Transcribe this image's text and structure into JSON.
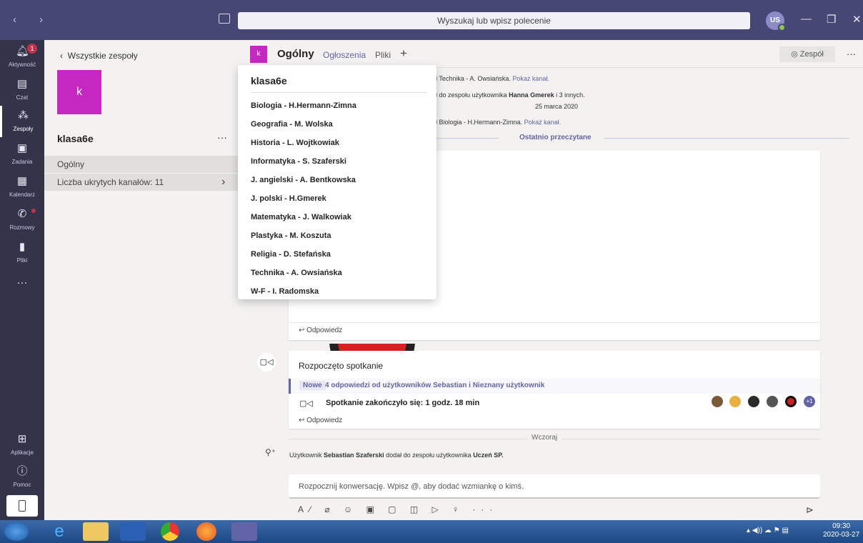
{
  "titlebar": {
    "nav_arrows": "‹ ›",
    "search_placeholder": "Wyszukaj lub wpisz polecenie",
    "avatar_initials": "US",
    "min": "—",
    "restore": "❐",
    "close": "✕"
  },
  "rail": [
    {
      "label": "Aktywność",
      "icon": "bell-icon",
      "badge": "1"
    },
    {
      "label": "Czat",
      "icon": "chat-icon"
    },
    {
      "label": "Zespoły",
      "icon": "teams-icon",
      "active": true
    },
    {
      "label": "Zadania",
      "icon": "assignments-icon"
    },
    {
      "label": "Kalendarz",
      "icon": "calendar-icon"
    },
    {
      "label": "Rozmowy",
      "icon": "phone-icon"
    },
    {
      "label": "Pliki",
      "icon": "file-icon"
    },
    {
      "label": "",
      "icon": "more-icon"
    },
    {
      "label": "Aplikacje",
      "icon": "apps-icon"
    },
    {
      "label": "Pomoc",
      "icon": "help-icon"
    }
  ],
  "left": {
    "back_label": "Wszystkie zespoły",
    "team_initial": "k",
    "team_name": "klasa6e",
    "more": "···",
    "channel_general": "Ogólny",
    "hidden_channels": "Liczba ukrytych kanałów: 11"
  },
  "header": {
    "tile_initial": "k",
    "title": "Ogólny",
    "tab_posts": "Ogłoszenia",
    "tab_files": "Pliki",
    "add": "+",
    "team_button": "◎ Zespół",
    "more": "···"
  },
  "feed": {
    "sys1_pre": "ł Technika - A. Owsiańska.",
    "sys1_link": "Pokaż kanał.",
    "sys2_pre": "ł do zespołu użytkownika",
    "sys2_bold": "Hanna Gmerek",
    "sys2_post": "i 3 innych.",
    "date": "25 marca 2020",
    "sys3_pre": "ł Biologia - H.Hermann-Zimna.",
    "sys3_link": "Pokaż kanał.",
    "last_read": "Ostatnio przeczytane",
    "reply1": "↩ Odpowiedz",
    "meeting_title": "Rozpoczęto spotkanie",
    "new_badge": "Nowe",
    "new_text": "4 odpowiedzi od użytkowników Sebastian i Nieznany użytkownik",
    "meeting_end": "Spotkanie zakończyło się: 1 godz. 18 min",
    "plus_count": "+1",
    "reply2": "↩ Odpowiedz",
    "yesterday": "Wczoraj",
    "added_pre": "Użytkownik",
    "added_user": "Sebastian Szaferski",
    "added_mid": "dodał do zespołu użytkownika",
    "added_target": "Uczeń SP.",
    "compose_placeholder": "Rozpocznij konwersację. Wpisz @, aby dodać wzmiankę o kimś.",
    "tools": "A⁄ ⌀ ☺ ▣ ▢ ◫ ▷ ♀ ···",
    "send": "⊳"
  },
  "dropdown": {
    "title": "klasa6e",
    "items": [
      "Biologia - H.Hermann-Zimna",
      "Geografia - M. Wolska",
      "Historia - L. Wojtkowiak",
      "Informatyka - S. Szaferski",
      "J. angielski - A. Bentkowska",
      "J. polski - H.Gmerek",
      "Matematyka - J. Walkowiak",
      "Plastyka - M. Koszuta",
      "Religia - D. Stefańska",
      "Technika - A. Owsiańska",
      "W-F - I. Radomska"
    ]
  },
  "taskbar": {
    "time": "09:30",
    "date": "2020-03-27"
  },
  "colors": {
    "brand": "#464775",
    "accent": "#6264a7",
    "team_tile": "#c428c0",
    "rail": "#33344a"
  }
}
